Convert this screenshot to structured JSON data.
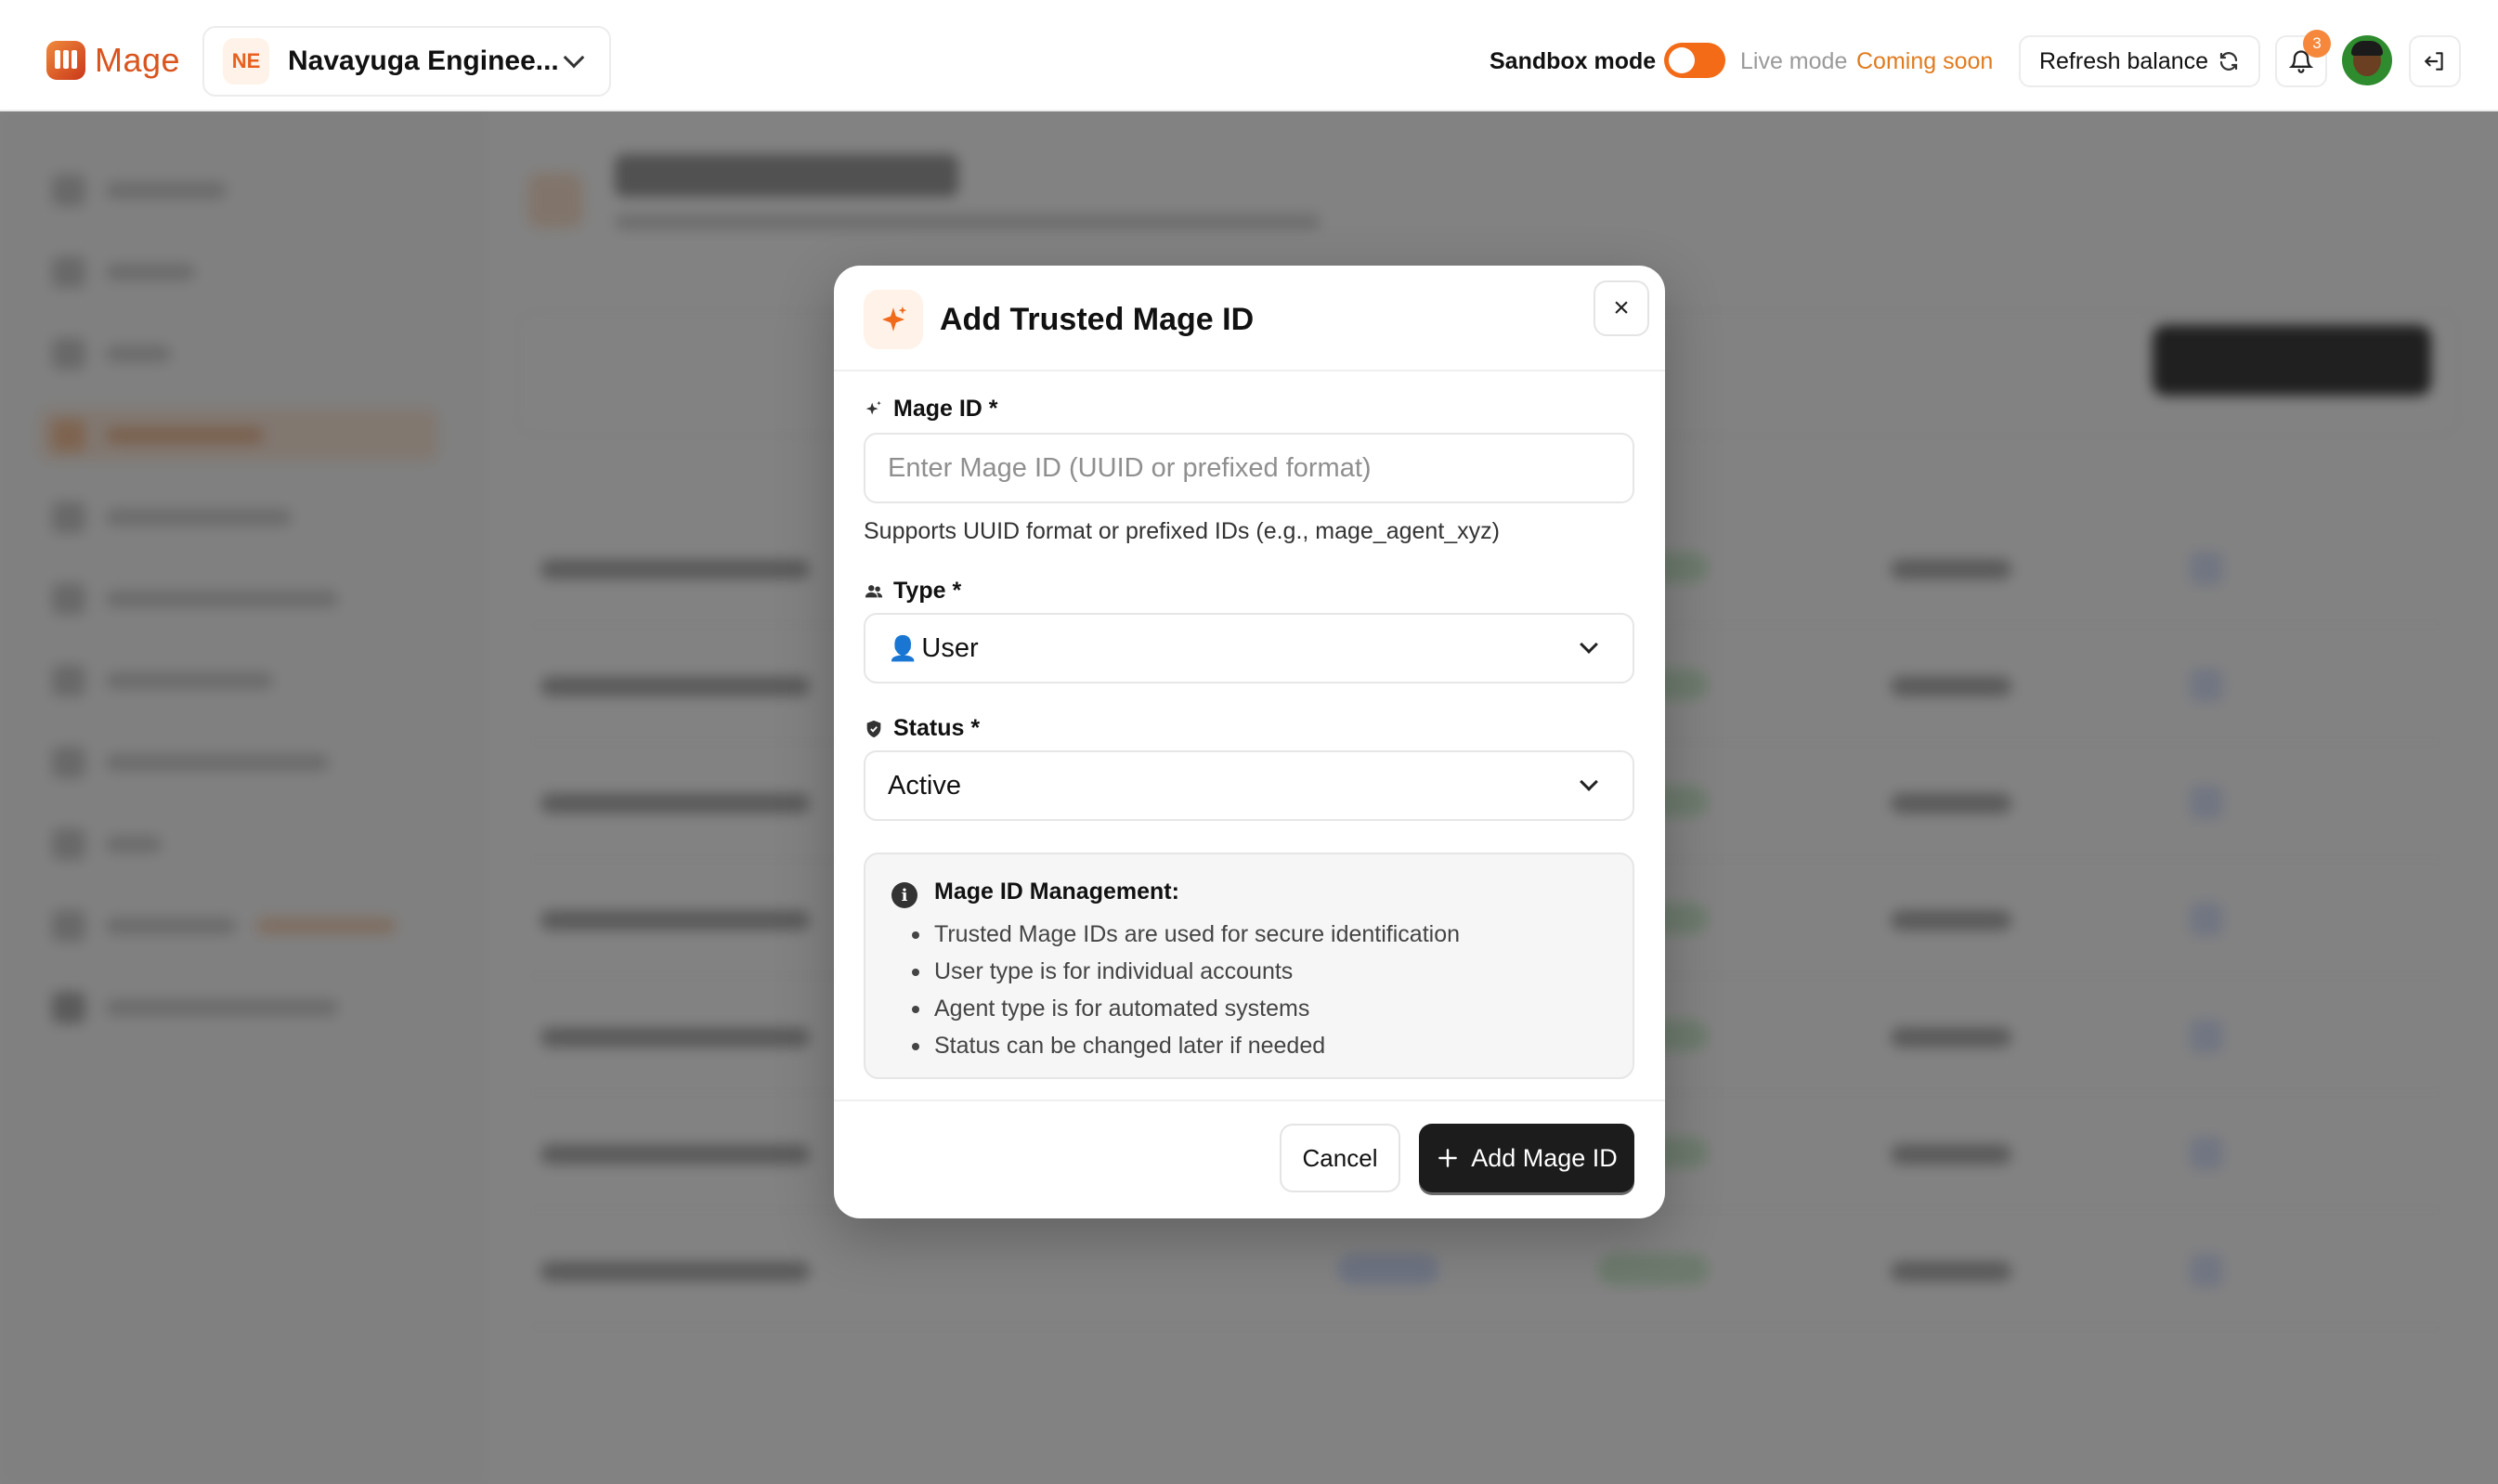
{
  "app": {
    "name": "Mage"
  },
  "org": {
    "initials": "NE",
    "name": "Navayuga Enginee..."
  },
  "header": {
    "sandbox_label": "Sandbox mode",
    "sandbox_enabled": true,
    "live_label": "Live mode",
    "coming_soon": "Coming soon",
    "refresh_label": "Refresh balance",
    "notification_count": "3"
  },
  "modal": {
    "title": "Add Trusted Mage ID",
    "close_label": "×",
    "mage_id": {
      "label": "Mage ID *",
      "placeholder": "Enter Mage ID (UUID or prefixed format)",
      "value": "",
      "help": "Supports UUID format or prefixed IDs (e.g., mage_agent_xyz)"
    },
    "type": {
      "label": "Type *",
      "icon": "👤",
      "value": "User"
    },
    "status": {
      "label": "Status *",
      "value": "Active"
    },
    "info": {
      "title": "Mage ID Management:",
      "items": [
        "Trusted Mage IDs are used for secure identification",
        "User type is for individual accounts",
        "Agent type is for automated systems",
        "Status can be changed later if needed"
      ]
    },
    "cancel_label": "Cancel",
    "submit_label": "Add Mage ID"
  },
  "colors": {
    "brand": "#d9541f",
    "toggle": "#f36b16",
    "coming_soon": "#e07b1f",
    "primary_button": "#1c1c1c"
  }
}
